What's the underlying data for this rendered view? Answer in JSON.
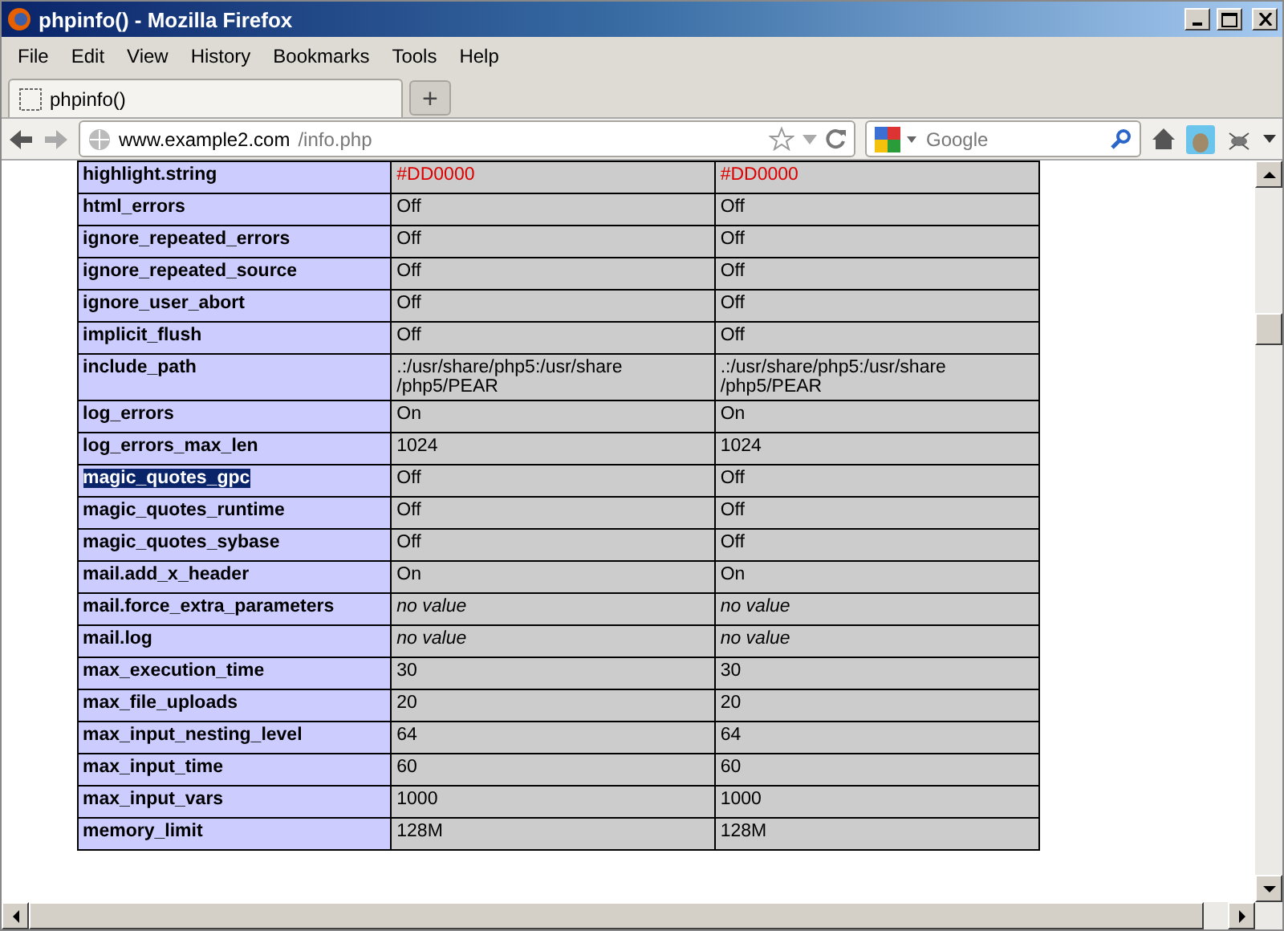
{
  "window": {
    "title": "phpinfo() - Mozilla Firefox"
  },
  "menu": [
    "File",
    "Edit",
    "View",
    "History",
    "Bookmarks",
    "Tools",
    "Help"
  ],
  "tabs": [
    {
      "label": "phpinfo()",
      "selected": true
    }
  ],
  "new_tab": "+",
  "address": {
    "domain": "www.example2.com",
    "path": "/info.php"
  },
  "search": {
    "placeholder": "Google"
  },
  "rows": [
    {
      "name": "highlight.string",
      "local": "#DD0000",
      "master": "#DD0000",
      "kind": "color",
      "highlighted": false
    },
    {
      "name": "html_errors",
      "local": "Off",
      "master": "Off",
      "kind": "text",
      "highlighted": false
    },
    {
      "name": "ignore_repeated_errors",
      "local": "Off",
      "master": "Off",
      "kind": "text",
      "highlighted": false
    },
    {
      "name": "ignore_repeated_source",
      "local": "Off",
      "master": "Off",
      "kind": "text",
      "highlighted": false
    },
    {
      "name": "ignore_user_abort",
      "local": "Off",
      "master": "Off",
      "kind": "text",
      "highlighted": false
    },
    {
      "name": "implicit_flush",
      "local": "Off",
      "master": "Off",
      "kind": "text",
      "highlighted": false
    },
    {
      "name": "include_path",
      "local": ".:/usr/share/php5:/usr/share /php5/PEAR",
      "master": ".:/usr/share/php5:/usr/share /php5/PEAR",
      "kind": "text",
      "highlighted": false
    },
    {
      "name": "log_errors",
      "local": "On",
      "master": "On",
      "kind": "text",
      "highlighted": false
    },
    {
      "name": "log_errors_max_len",
      "local": "1024",
      "master": "1024",
      "kind": "text",
      "highlighted": false
    },
    {
      "name": "magic_quotes_gpc",
      "local": "Off",
      "master": "Off",
      "kind": "text",
      "highlighted": true
    },
    {
      "name": "magic_quotes_runtime",
      "local": "Off",
      "master": "Off",
      "kind": "text",
      "highlighted": false
    },
    {
      "name": "magic_quotes_sybase",
      "local": "Off",
      "master": "Off",
      "kind": "text",
      "highlighted": false
    },
    {
      "name": "mail.add_x_header",
      "local": "On",
      "master": "On",
      "kind": "text",
      "highlighted": false
    },
    {
      "name": "mail.force_extra_parameters",
      "local": "no value",
      "master": "no value",
      "kind": "none",
      "highlighted": false
    },
    {
      "name": "mail.log",
      "local": "no value",
      "master": "no value",
      "kind": "none",
      "highlighted": false
    },
    {
      "name": "max_execution_time",
      "local": "30",
      "master": "30",
      "kind": "text",
      "highlighted": false
    },
    {
      "name": "max_file_uploads",
      "local": "20",
      "master": "20",
      "kind": "text",
      "highlighted": false
    },
    {
      "name": "max_input_nesting_level",
      "local": "64",
      "master": "64",
      "kind": "text",
      "highlighted": false
    },
    {
      "name": "max_input_time",
      "local": "60",
      "master": "60",
      "kind": "text",
      "highlighted": false
    },
    {
      "name": "max_input_vars",
      "local": "1000",
      "master": "1000",
      "kind": "text",
      "highlighted": false
    },
    {
      "name": "memory_limit",
      "local": "128M",
      "master": "128M",
      "kind": "text",
      "highlighted": false
    }
  ]
}
